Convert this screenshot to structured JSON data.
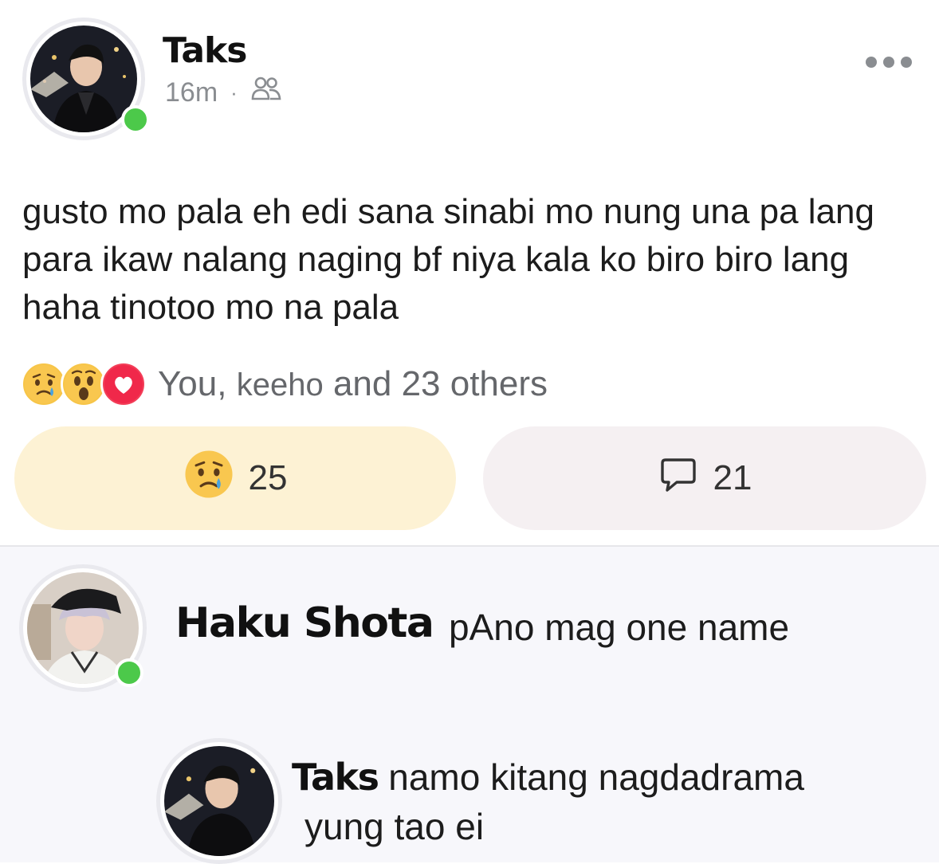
{
  "post": {
    "author": "Taks",
    "time": "16m",
    "separator": "·",
    "audience_icon": "friends-icon",
    "more_icon": "more-horizontal-icon",
    "text": "gusto mo pala eh edi sana sinabi mo nung una pa lang para ikaw nalang naging bf niya kala ko biro biro lang haha tinotoo mo na pala",
    "reactions": {
      "icons": [
        "sad-face-icon",
        "wow-face-icon",
        "heart-icon"
      ],
      "you": "You,",
      "name": "keeho",
      "rest": "and 23 others"
    },
    "react_button": {
      "icon": "sad-face-icon",
      "count": "25"
    },
    "comment_button": {
      "icon": "comment-bubble-icon",
      "count": "21"
    }
  },
  "comments": [
    {
      "author": "Haku Shota",
      "text": "pAno mag one name"
    },
    {
      "author": "Taks",
      "text_line1": "namo kitang nagdadrama",
      "text_line2": "yung tao ei"
    }
  ],
  "colors": {
    "online": "#4cc94a",
    "react_button_bg": "#fdf2d4",
    "comment_button_bg": "#f5f0f2",
    "comments_bg": "#f7f7fb"
  }
}
